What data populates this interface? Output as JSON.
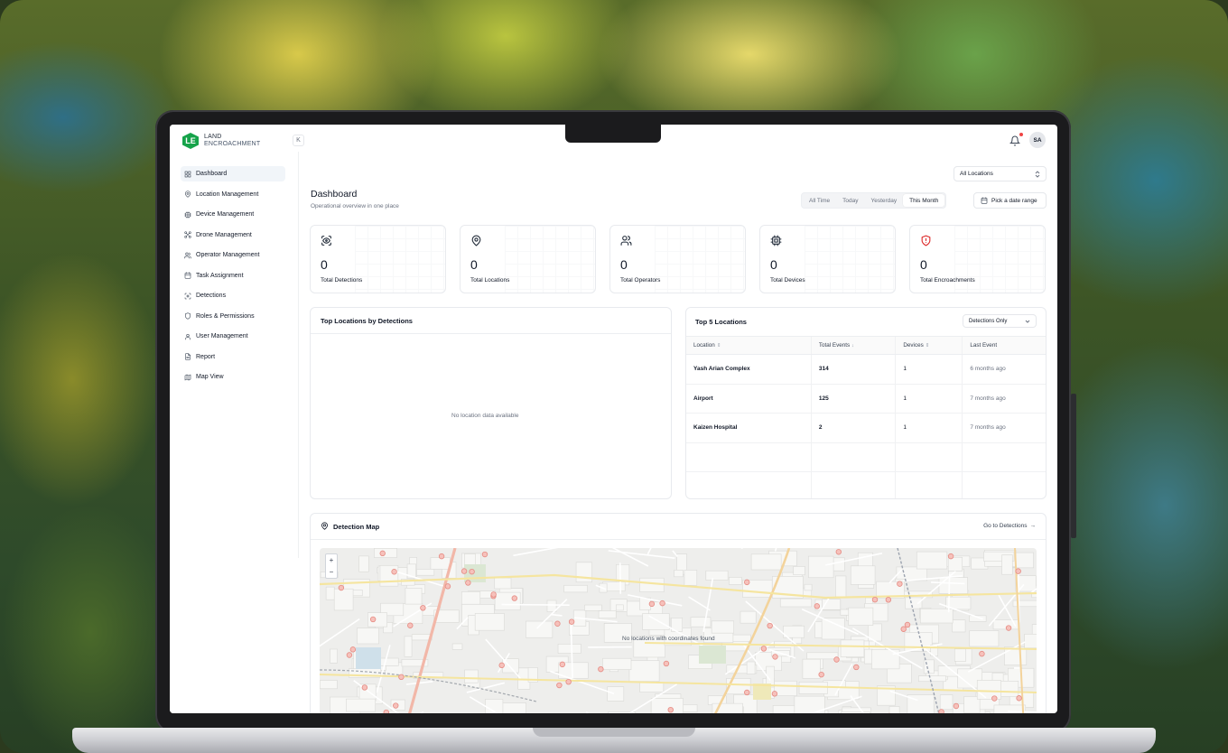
{
  "logo": {
    "mark": "LE",
    "line1": "LAND",
    "line2": "ENCROACHMENT"
  },
  "sidebar": {
    "collapse_glyph": "K",
    "items": [
      {
        "label": "Dashboard",
        "icon": "grid-icon"
      },
      {
        "label": "Location Management",
        "icon": "map-pin-icon"
      },
      {
        "label": "Device Management",
        "icon": "chip-icon"
      },
      {
        "label": "Drone Management",
        "icon": "drone-icon"
      },
      {
        "label": "Operator Management",
        "icon": "users-icon"
      },
      {
        "label": "Task Assignment",
        "icon": "calendar-icon"
      },
      {
        "label": "Detections",
        "icon": "scan-icon"
      },
      {
        "label": "Roles & Permissions",
        "icon": "shield-icon"
      },
      {
        "label": "User Management",
        "icon": "user-icon"
      },
      {
        "label": "Report",
        "icon": "file-icon"
      },
      {
        "label": "Map View",
        "icon": "map-icon"
      }
    ]
  },
  "header": {
    "avatar_initials": "SA",
    "location_filter": "All Locations"
  },
  "page": {
    "title": "Dashboard",
    "subtitle": "Operational overview in one place"
  },
  "range_tabs": [
    "All Time",
    "Today",
    "Yesterday",
    "This Month"
  ],
  "range_selected": "This Month",
  "date_range_button": "Pick a date range",
  "stats": [
    {
      "value": "0",
      "label": "Total Detections",
      "icon": "scan-eye-icon",
      "color": "#1f2937"
    },
    {
      "value": "0",
      "label": "Total Locations",
      "icon": "map-pin-icon",
      "color": "#1f2937"
    },
    {
      "value": "0",
      "label": "Total Operators",
      "icon": "users-icon",
      "color": "#1f2937"
    },
    {
      "value": "0",
      "label": "Total Devices",
      "icon": "chip-icon",
      "color": "#1f2937"
    },
    {
      "value": "0",
      "label": "Total Encroachments",
      "icon": "shield-alert-icon",
      "color": "#dc2626"
    }
  ],
  "top_locations_chart": {
    "title": "Top Locations by Detections",
    "empty": "No location data available"
  },
  "top5": {
    "title": "Top 5 Locations",
    "filter": "Detections Only",
    "columns": [
      "Location",
      "Total Events",
      "Devices",
      "Last Event"
    ],
    "rows": [
      {
        "location": "Yash Arian Complex",
        "events": "314",
        "devices": "1",
        "last": "6 months ago"
      },
      {
        "location": "Airport",
        "events": "125",
        "devices": "1",
        "last": "7 months ago"
      },
      {
        "location": "Kaizen Hospital",
        "events": "2",
        "devices": "1",
        "last": "7 months ago"
      }
    ]
  },
  "detection_map": {
    "title": "Detection Map",
    "link": "Go to Detections",
    "empty": "No locations with coordinates found",
    "zoom_in": "+",
    "zoom_out": "−"
  }
}
